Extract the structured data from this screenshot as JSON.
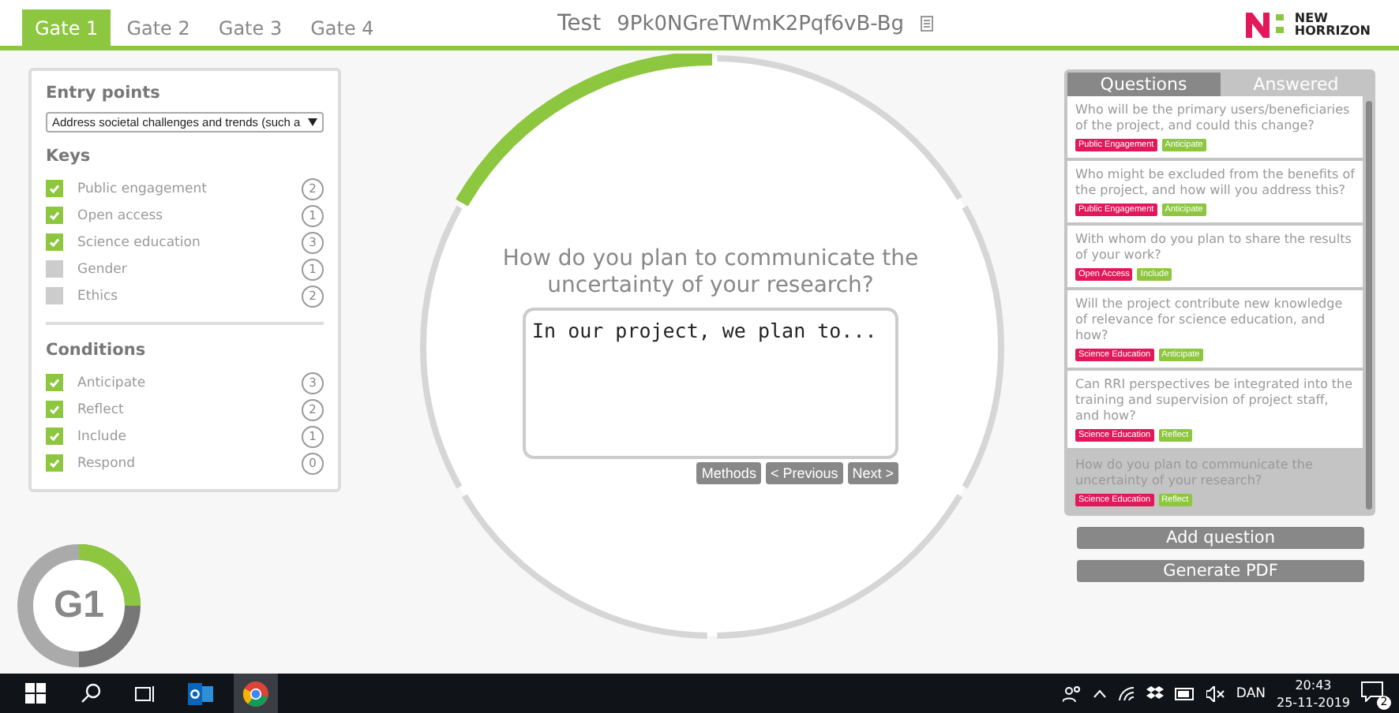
{
  "gate_tabs": [
    {
      "label": "Gate 1",
      "selected": true
    },
    {
      "label": "Gate 2",
      "selected": false
    },
    {
      "label": "Gate 3",
      "selected": false
    },
    {
      "label": "Gate 4",
      "selected": false
    }
  ],
  "header": {
    "title": "Test",
    "code": "9Pk0NGreTWmK2Pqf6vB-Bg",
    "logo_line_1": "NEW",
    "logo_line_2": "HORRIZON"
  },
  "filters": {
    "entry_points_title": "Entry points",
    "entry_point_value": "Address societal challenges and trends (such a",
    "keys_title": "Keys",
    "keys": [
      {
        "label": "Public engagement",
        "checked": true,
        "count": "2"
      },
      {
        "label": "Open access",
        "checked": true,
        "count": "1"
      },
      {
        "label": "Science education",
        "checked": true,
        "count": "3"
      },
      {
        "label": "Gender",
        "checked": false,
        "count": "1"
      },
      {
        "label": "Ethics",
        "checked": false,
        "count": "2"
      }
    ],
    "conditions_title": "Conditions",
    "conditions": [
      {
        "label": "Anticipate",
        "checked": true,
        "count": "3"
      },
      {
        "label": "Reflect",
        "checked": true,
        "count": "2"
      },
      {
        "label": "Include",
        "checked": true,
        "count": "1"
      },
      {
        "label": "Respond",
        "checked": true,
        "count": "0"
      }
    ]
  },
  "progress": {
    "level": 0.1667
  },
  "gate_badge": {
    "label": "G1"
  },
  "question": {
    "text": "How do you plan to communicate the uncertainty of your research?",
    "answer": "In our project, we plan to...",
    "buttons": [
      "Methods",
      "< Previous",
      "Next >"
    ]
  },
  "question_tabs": [
    {
      "label": "Questions",
      "selected": true
    },
    {
      "label": "Answered",
      "selected": false
    }
  ],
  "questions": [
    {
      "text": "Who will be the primary users/beneficiaries of the project, and could this change?",
      "selected": false,
      "tags": [
        {
          "label": "Public Engagement",
          "kind": "key"
        },
        {
          "label": "Anticipate",
          "kind": "condition"
        }
      ]
    },
    {
      "text": "Who might be excluded from the benefits of the project, and how will you address this?",
      "selected": false,
      "tags": [
        {
          "label": "Public Engagement",
          "kind": "key"
        },
        {
          "label": "Anticipate",
          "kind": "condition"
        }
      ]
    },
    {
      "text": "With whom do you plan to share the results of your work?",
      "selected": false,
      "tags": [
        {
          "label": "Open Access",
          "kind": "key"
        },
        {
          "label": "Include",
          "kind": "condition"
        }
      ]
    },
    {
      "text": "Will the project contribute new knowledge of relevance for science education, and how?",
      "selected": false,
      "tags": [
        {
          "label": "Science Education",
          "kind": "key"
        },
        {
          "label": "Anticipate",
          "kind": "condition"
        }
      ]
    },
    {
      "text": "Can RRI perspectives be integrated into the training and supervision of project staff, and how?",
      "selected": false,
      "tags": [
        {
          "label": "Science Education",
          "kind": "key"
        },
        {
          "label": "Reflect",
          "kind": "condition"
        }
      ]
    },
    {
      "text": "How do you plan to communicate the uncertainty of your research?",
      "selected": true,
      "tags": [
        {
          "label": "Science Education",
          "kind": "key"
        },
        {
          "label": "Reflect",
          "kind": "condition"
        }
      ]
    }
  ],
  "actions": [
    "Add question",
    "Generate PDF"
  ],
  "taskbar": {
    "language": "DAN",
    "time": "20:43",
    "date": "25-11-2019",
    "notifications": "2"
  }
}
